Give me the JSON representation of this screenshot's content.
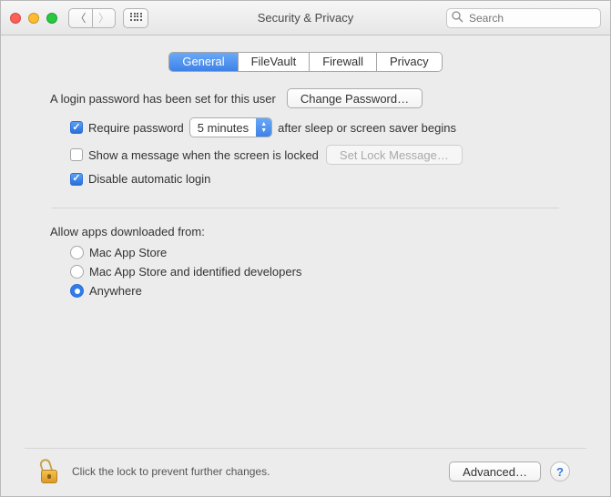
{
  "window": {
    "title": "Security & Privacy"
  },
  "search": {
    "placeholder": "Search",
    "value": ""
  },
  "tabs": {
    "general": "General",
    "filevault": "FileVault",
    "firewall": "Firewall",
    "privacy": "Privacy",
    "active": "general"
  },
  "general": {
    "login_set_text": "A login password has been set for this user",
    "change_password_btn": "Change Password…",
    "require_password_label": "Require password",
    "require_password_checked": true,
    "sleep_delay_value": "5 minutes",
    "after_sleep_text": "after sleep or screen saver begins",
    "show_message_label": "Show a message when the screen is locked",
    "show_message_checked": false,
    "set_lock_message_btn": "Set Lock Message…",
    "disable_auto_login_label": "Disable automatic login",
    "disable_auto_login_checked": true,
    "allow_apps_heading": "Allow apps downloaded from:",
    "radio_mas": "Mac App Store",
    "radio_mas_dev": "Mac App Store and identified developers",
    "radio_anywhere": "Anywhere",
    "radio_selected": "anywhere"
  },
  "footer": {
    "lock_text": "Click the lock to prevent further changes.",
    "advanced_btn": "Advanced…",
    "help_btn": "?"
  }
}
